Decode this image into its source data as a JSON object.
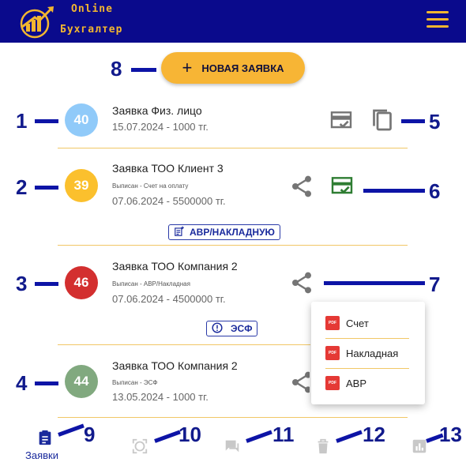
{
  "header": {
    "brand_line1": "Online",
    "brand_line2": "Бухгалтер",
    "accent": "#f2b630",
    "background": "#0a0a8c"
  },
  "new_request": {
    "label": "НОВАЯ ЗАЯВКА",
    "icon": "plus-icon"
  },
  "requests": [
    {
      "badge": "40",
      "badge_color": "#90caf9",
      "title": "Заявка Физ. лицо",
      "status": "",
      "date_amount": "15.07.2024 - 1000 тг."
    },
    {
      "badge": "39",
      "badge_color": "#fbc02d",
      "title": "Заявка ТОО Клиент 3",
      "status": "Выписан - Счет на оплату",
      "date_amount": "07.06.2024 - 5500000 тг.",
      "action": "АВР/НАКЛАДНУЮ"
    },
    {
      "badge": "46",
      "badge_color": "#d32f2f",
      "title": "Заявка ТОО Компания 2",
      "status": "Выписан - АВР/Накладная",
      "date_amount": "07.06.2024 - 4500000 тг.",
      "action": "ЭСФ"
    },
    {
      "badge": "44",
      "badge_color": "#81a97f",
      "title": "Заявка ТОО Компания 2",
      "status": "Выписан - ЭСФ",
      "date_amount": "13.05.2024 - 1000 тг."
    }
  ],
  "share_menu": {
    "items": [
      "Счет",
      "Накладная",
      "АВР"
    ],
    "icon": "pdf-icon"
  },
  "bottom_nav": {
    "active_label": "Заявки"
  },
  "annotations": [
    "1",
    "2",
    "3",
    "4",
    "5",
    "6",
    "7",
    "8",
    "9",
    "10",
    "11",
    "12",
    "13"
  ]
}
